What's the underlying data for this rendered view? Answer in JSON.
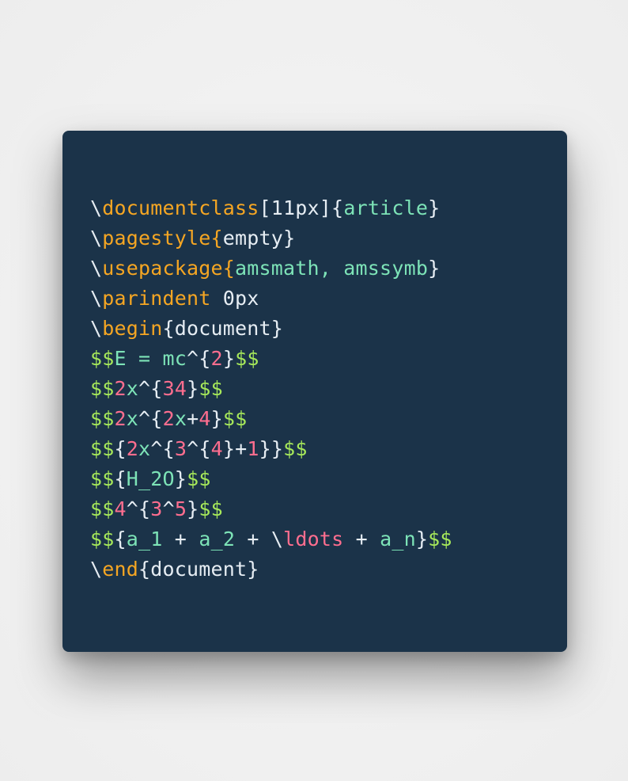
{
  "colors": {
    "background": "#ededed",
    "card": "#1b3349",
    "plain": "#e6edf3",
    "command": "#f5a623",
    "argument": "#7de3b7",
    "math_delimiter": "#a6e85a",
    "number": "#ff6e8f"
  },
  "code_lines": [
    [
      {
        "text": "\\",
        "kind": "plain"
      },
      {
        "text": "documentclass",
        "kind": "cmd"
      },
      {
        "text": "[11px]{",
        "kind": "plain"
      },
      {
        "text": "article",
        "kind": "str"
      },
      {
        "text": "}",
        "kind": "plain"
      }
    ],
    [
      {
        "text": "\\",
        "kind": "plain"
      },
      {
        "text": "pagestyle",
        "kind": "cmd"
      },
      {
        "text": "{",
        "kind": "cmd"
      },
      {
        "text": "empty",
        "kind": "plain"
      },
      {
        "text": "}",
        "kind": "plain"
      }
    ],
    [
      {
        "text": "\\",
        "kind": "plain"
      },
      {
        "text": "usepackage",
        "kind": "cmd"
      },
      {
        "text": "{",
        "kind": "cmd"
      },
      {
        "text": "amsmath, amssymb",
        "kind": "str"
      },
      {
        "text": "}",
        "kind": "plain"
      }
    ],
    [
      {
        "text": "\\",
        "kind": "plain"
      },
      {
        "text": "parindent",
        "kind": "cmd"
      },
      {
        "text": " 0px",
        "kind": "plain"
      }
    ],
    [
      {
        "text": "\\",
        "kind": "plain"
      },
      {
        "text": "begin",
        "kind": "cmd"
      },
      {
        "text": "{document}",
        "kind": "plain"
      }
    ],
    [
      {
        "text": "$$",
        "kind": "math"
      },
      {
        "text": "E = mc",
        "kind": "str"
      },
      {
        "text": "^{",
        "kind": "plain"
      },
      {
        "text": "2",
        "kind": "num"
      },
      {
        "text": "}",
        "kind": "plain"
      },
      {
        "text": "$$",
        "kind": "math"
      }
    ],
    [
      {
        "text": "$$",
        "kind": "math"
      },
      {
        "text": "2",
        "kind": "num"
      },
      {
        "text": "x",
        "kind": "str"
      },
      {
        "text": "^{",
        "kind": "plain"
      },
      {
        "text": "34",
        "kind": "num"
      },
      {
        "text": "}",
        "kind": "plain"
      },
      {
        "text": "$$",
        "kind": "math"
      }
    ],
    [
      {
        "text": "$$",
        "kind": "math"
      },
      {
        "text": "2",
        "kind": "num"
      },
      {
        "text": "x",
        "kind": "str"
      },
      {
        "text": "^{",
        "kind": "plain"
      },
      {
        "text": "2",
        "kind": "num"
      },
      {
        "text": "x",
        "kind": "str"
      },
      {
        "text": "+",
        "kind": "plain"
      },
      {
        "text": "4",
        "kind": "num"
      },
      {
        "text": "}",
        "kind": "plain"
      },
      {
        "text": "$$",
        "kind": "math"
      }
    ],
    [
      {
        "text": "$$",
        "kind": "math"
      },
      {
        "text": "{",
        "kind": "plain"
      },
      {
        "text": "2",
        "kind": "num"
      },
      {
        "text": "x",
        "kind": "str"
      },
      {
        "text": "^{",
        "kind": "plain"
      },
      {
        "text": "3",
        "kind": "num"
      },
      {
        "text": "^{",
        "kind": "plain"
      },
      {
        "text": "4",
        "kind": "num"
      },
      {
        "text": "}+",
        "kind": "plain"
      },
      {
        "text": "1",
        "kind": "num"
      },
      {
        "text": "}}",
        "kind": "plain"
      },
      {
        "text": "$$",
        "kind": "math"
      }
    ],
    [
      {
        "text": "$$",
        "kind": "math"
      },
      {
        "text": "{",
        "kind": "plain"
      },
      {
        "text": "H_2O",
        "kind": "str"
      },
      {
        "text": "}",
        "kind": "plain"
      },
      {
        "text": "$$",
        "kind": "math"
      }
    ],
    [
      {
        "text": "$$",
        "kind": "math"
      },
      {
        "text": "4",
        "kind": "num"
      },
      {
        "text": "^{",
        "kind": "plain"
      },
      {
        "text": "3",
        "kind": "num"
      },
      {
        "text": "^",
        "kind": "plain"
      },
      {
        "text": "5",
        "kind": "num"
      },
      {
        "text": "}",
        "kind": "plain"
      },
      {
        "text": "$$",
        "kind": "math"
      }
    ],
    [
      {
        "text": "$$",
        "kind": "math"
      },
      {
        "text": "{",
        "kind": "plain"
      },
      {
        "text": "a_1",
        "kind": "str"
      },
      {
        "text": " + ",
        "kind": "plain"
      },
      {
        "text": "a_2",
        "kind": "str"
      },
      {
        "text": " + \\",
        "kind": "plain"
      },
      {
        "text": "ldots",
        "kind": "num"
      },
      {
        "text": " + ",
        "kind": "plain"
      },
      {
        "text": "a_n",
        "kind": "str"
      },
      {
        "text": "}",
        "kind": "plain"
      },
      {
        "text": "$$",
        "kind": "math"
      }
    ],
    [
      {
        "text": "\\",
        "kind": "plain"
      },
      {
        "text": "end",
        "kind": "cmd"
      },
      {
        "text": "{document}",
        "kind": "plain"
      }
    ]
  ]
}
